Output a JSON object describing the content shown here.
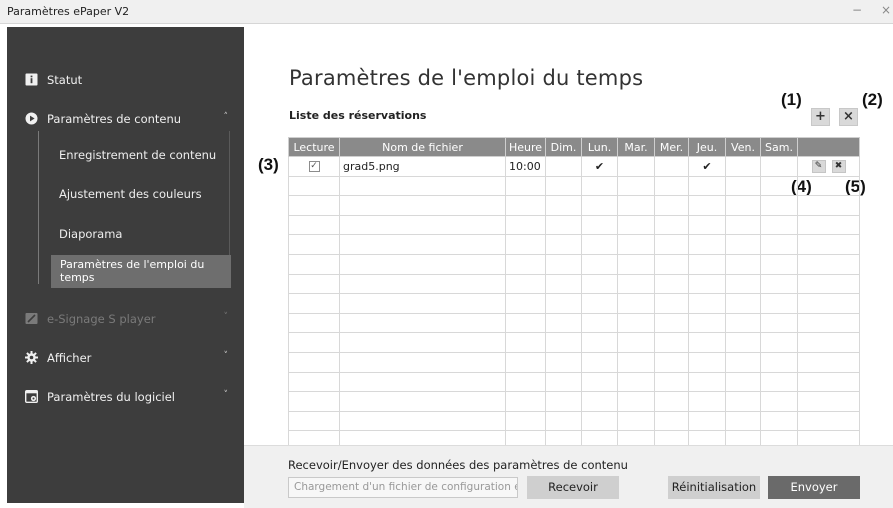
{
  "window": {
    "title": "Paramètres ePaper V2",
    "minimize_glyph": "−",
    "close_glyph": "×"
  },
  "sidebar": {
    "items": [
      {
        "label": "Statut",
        "icon": "info-icon"
      },
      {
        "label": "Paramètres de contenu",
        "icon": "play-circle-icon",
        "caret": "˄"
      },
      {
        "label": "e-Signage S player",
        "icon": "player-icon",
        "caret": "˅"
      },
      {
        "label": "Afficher",
        "icon": "gear-icon",
        "caret": "˅"
      },
      {
        "label": "Paramètres du logiciel",
        "icon": "software-settings-icon",
        "caret": "˅"
      }
    ],
    "subitems": [
      "Enregistrement de contenu",
      "Ajustement des couleurs",
      "Diaporama",
      "Paramètres de l'emploi du temps"
    ]
  },
  "main": {
    "title": "Paramètres de l'emploi du temps",
    "list_label": "Liste des réservations",
    "add_glyph": "+",
    "delete_glyph": "×",
    "callouts": [
      "(1)",
      "(2)",
      "(3)",
      "(4)",
      "(5)"
    ]
  },
  "table": {
    "headers": [
      "Lecture",
      "Nom de fichier",
      "Heure",
      "Dim.",
      "Lun.",
      "Mar.",
      "Mer.",
      "Jeu.",
      "Ven.",
      "Sam.",
      ""
    ],
    "rows": [
      {
        "checked": true,
        "check_glyph": "✓",
        "filename": "grad5.png",
        "time": "10:00",
        "days": [
          "",
          "✔",
          "",
          "",
          "✔",
          "",
          ""
        ],
        "edit_glyph": "✎",
        "remove_glyph": "✖"
      }
    ],
    "empty_rows": 14
  },
  "footer": {
    "label": "Recevoir/Envoyer des données des paramètres de contenu",
    "input_placeholder": "Chargement d'un fichier de configuration existant",
    "receive_label": "Recevoir",
    "reset_label": "Réinitialisation",
    "send_label": "Envoyer"
  },
  "colors": {
    "sidebar_bg": "#3d3d3d",
    "sidebar_active": "#6e6e6e",
    "table_header": "#8a8a8a",
    "send_button": "#6a6a6a",
    "button_gray": "#cfcfcf"
  }
}
